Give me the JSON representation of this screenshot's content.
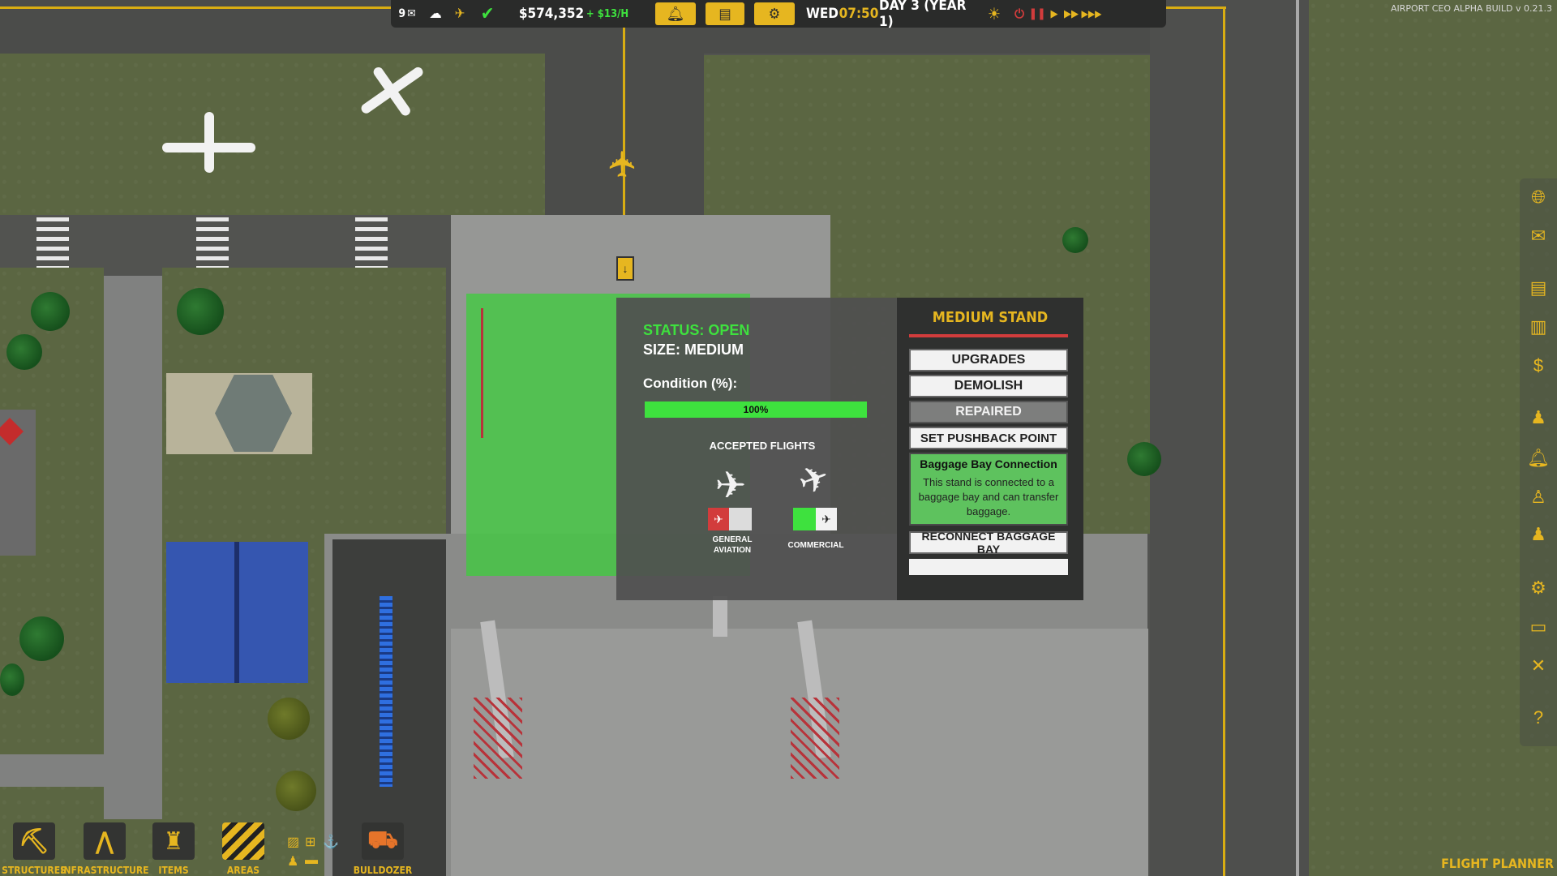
{
  "version_text": "AIRPORT CEO ALPHA BUILD v 0.21.3",
  "topbar": {
    "mail_count": "9",
    "money": "$574,352",
    "income": "+ $13/H",
    "day_of_week": "WED",
    "time": "07:50",
    "day_label": "DAY 3 (YEAR 1)"
  },
  "stand_panel": {
    "title": "MEDIUM STAND",
    "status_label": "STATUS: OPEN",
    "size_label": "SIZE: MEDIUM",
    "condition_label": "Condition (%):",
    "condition_value": "100%",
    "condition_fraction": 1.0,
    "accepted_flights_label": "ACCEPTED FLIGHTS",
    "flight_types": [
      {
        "label_line1": "GENERAL",
        "label_line2": "AVIATION",
        "enabled": false
      },
      {
        "label_line1": "COMMERCIAL",
        "label_line2": "",
        "enabled": true
      }
    ],
    "buttons": {
      "upgrades": "UPGRADES",
      "demolish": "DEMOLISH",
      "repaired": "REPAIRED",
      "set_pushback": "SET PUSHBACK POINT",
      "reconnect_baggage": "RECONNECT BAGGAGE BAY"
    },
    "baggage_box": {
      "title": "Baggage Bay Connection",
      "body": "This stand is connected to a baggage bay and can transfer baggage."
    }
  },
  "bottom_menu": [
    {
      "label": "STRUCTURES",
      "icon": "worker-icon"
    },
    {
      "label": "INFRASTRUCTURE",
      "icon": "road-icon"
    },
    {
      "label": "ITEMS",
      "icon": "desk-icon"
    },
    {
      "label": "AREAS",
      "icon": "hazard-stripes-icon"
    },
    {
      "label": "BULLDOZER",
      "icon": "bulldozer-icon"
    }
  ],
  "flight_planner_label": "FLIGHT PLANNER",
  "colors": {
    "accent": "#e6b620",
    "status_green": "#3ee13e",
    "stand_overlay": "#3ccd3c",
    "toggle_off": "#d23c3c"
  }
}
